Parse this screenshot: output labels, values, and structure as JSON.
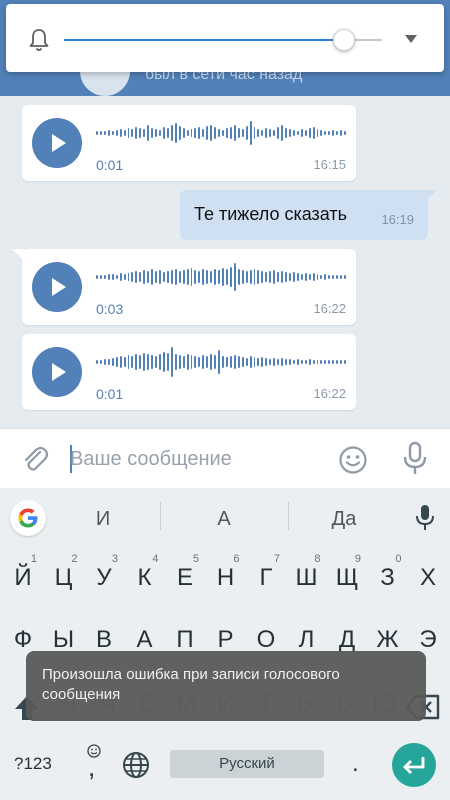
{
  "header": {
    "name": "",
    "status": "был в сети час назад"
  },
  "volume": {
    "level": 0.88,
    "bell_icon": "bell-icon",
    "expand_icon": "chevron-down-icon",
    "accent": "#2d87d8"
  },
  "messages": [
    {
      "type": "voice",
      "direction": "in",
      "duration": "0:01",
      "time": "16:15"
    },
    {
      "type": "text",
      "direction": "out",
      "text": "Те тижело сказать",
      "time": "16:19"
    },
    {
      "type": "voice",
      "direction": "in",
      "duration": "0:03",
      "time": "16:22"
    },
    {
      "type": "voice",
      "direction": "in",
      "duration": "0:01",
      "time": "16:22"
    }
  ],
  "composer": {
    "placeholder": "Ваше сообщение",
    "attach_icon": "paperclip-icon",
    "emoji_icon": "emoji-icon",
    "mic_icon": "microphone-icon"
  },
  "keyboard": {
    "suggestions": [
      "И",
      "А",
      "Да"
    ],
    "row1": [
      {
        "k": "Й",
        "h": "1"
      },
      {
        "k": "Ц",
        "h": "2"
      },
      {
        "k": "У",
        "h": "3"
      },
      {
        "k": "К",
        "h": "4"
      },
      {
        "k": "Е",
        "h": "5"
      },
      {
        "k": "Н",
        "h": "6"
      },
      {
        "k": "Г",
        "h": "7"
      },
      {
        "k": "Ш",
        "h": "8"
      },
      {
        "k": "Щ",
        "h": "9"
      },
      {
        "k": "З",
        "h": "0"
      },
      {
        "k": "Х",
        "h": ""
      }
    ],
    "row2": [
      "Ф",
      "Ы",
      "В",
      "А",
      "П",
      "Р",
      "О",
      "Л",
      "Д",
      "Ж",
      "Э"
    ],
    "row3": [
      "Я",
      "Ч",
      "С",
      "М",
      "И",
      "Т",
      "Ь",
      "Б",
      "Ю"
    ],
    "symbols_label": "?123",
    "space_label": "Русский",
    "period_label": ".",
    "comma_label": ",",
    "accent": "#26a69a"
  },
  "toast": {
    "text": "Произошла ошибка при записи голосового сообщения"
  },
  "colors": {
    "brand": "#5181b8",
    "outgoing_bubble": "#cfe0f3",
    "chat_bg": "#e6ebf0"
  }
}
